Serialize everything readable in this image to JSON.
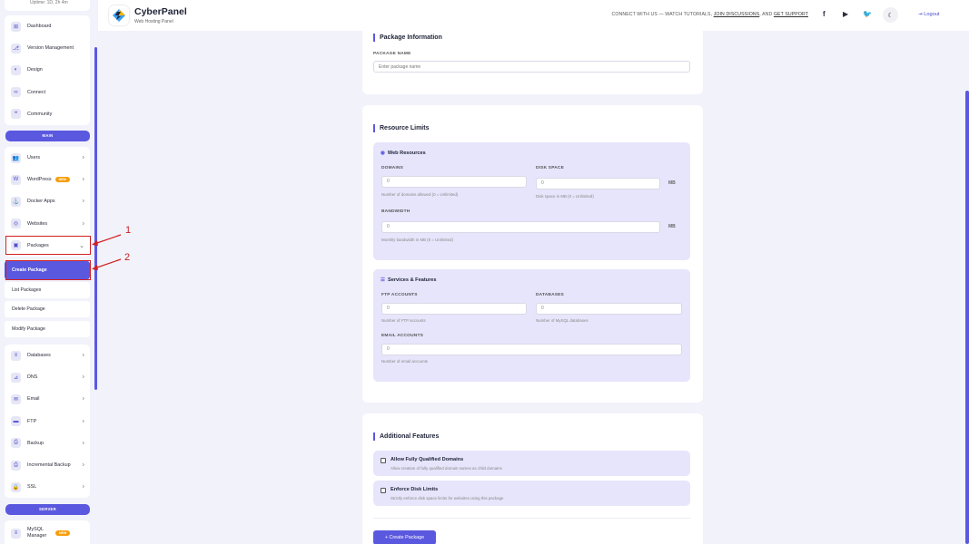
{
  "sidebar": {
    "uptime": "Uptime: 1D, 2h 4m",
    "top_items": [
      {
        "label": "Dashboard",
        "icon": "⊞"
      },
      {
        "label": "Version Management",
        "icon": "⎇"
      },
      {
        "label": "Design",
        "icon": "◐"
      },
      {
        "label": "Connect",
        "icon": "∞"
      },
      {
        "label": "Community",
        "icon": "❝"
      }
    ],
    "main_label": "MAIN",
    "main_items": [
      {
        "label": "Users",
        "icon": "👥"
      },
      {
        "label": "WordPress",
        "icon": "W",
        "badge": "NEW"
      },
      {
        "label": "Docker Apps",
        "icon": "⚓"
      },
      {
        "label": "Websites",
        "icon": "◎"
      },
      {
        "label": "Packages",
        "icon": "▣"
      }
    ],
    "package_sub": [
      "Create Package",
      "List Packages",
      "Delete Package",
      "Modify Package"
    ],
    "more_items": [
      {
        "label": "Databases",
        "icon": "≡"
      },
      {
        "label": "DNS",
        "icon": "⊿"
      },
      {
        "label": "Email",
        "icon": "✉"
      },
      {
        "label": "FTP",
        "icon": "▬"
      },
      {
        "label": "Backup",
        "icon": "⎙"
      },
      {
        "label": "Incremental Backup",
        "icon": "⎙"
      },
      {
        "label": "SSL",
        "icon": "🔒"
      }
    ],
    "server_label": "SERVER",
    "server_items": [
      {
        "label": "MySQL Manager",
        "icon": "≡",
        "badge": "NEW"
      }
    ]
  },
  "header": {
    "title": "CyberPanel",
    "subtitle": "Web Hosting Panel",
    "connect_prefix": "CONNECT WITH US — WATCH TUTORIALS,",
    "join_link": "JOIN DISCUSSIONS",
    "connect_mid": ", AND",
    "support_link": "GET SUPPORT",
    "logout": "Logout"
  },
  "package_info": {
    "title": "Package Information",
    "name_label": "PACKAGE NAME",
    "name_placeholder": "Enter package name"
  },
  "resource_limits": {
    "title": "Resource Limits",
    "web_resources": {
      "title": "Web Resources",
      "domains_label": "DOMAINS",
      "domains_value": "0",
      "domains_help": "Number of domains allowed (0 = Unlimited)",
      "disk_label": "DISK SPACE",
      "disk_value": "0",
      "disk_unit": "MB",
      "disk_help": "Disk space in MB (0 = Unlimited)",
      "bandwidth_label": "BANDWIDTH",
      "bandwidth_value": "0",
      "bandwidth_unit": "MB",
      "bandwidth_help": "Monthly bandwidth in MB (0 = Unlimited)"
    },
    "services": {
      "title": "Services & Features",
      "ftp_label": "FTP ACCOUNTS",
      "ftp_value": "0",
      "ftp_help": "Number of FTP accounts",
      "db_label": "DATABASES",
      "db_value": "0",
      "db_help": "Number of MySQL databases",
      "email_label": "EMAIL ACCOUNTS",
      "email_value": "0",
      "email_help": "Number of email accounts"
    }
  },
  "additional": {
    "title": "Additional Features",
    "fqdn_title": "Allow Fully Qualified Domains",
    "fqdn_desc": "Allow creation of fully qualified domain names as child domains",
    "disk_title": "Enforce Disk Limits",
    "disk_desc": "Strictly enforce disk space limits for websites using this package",
    "create_button": "+ Create Package"
  },
  "annotations": {
    "one": "1",
    "two": "2"
  },
  "colors": {
    "accent": "#5b58e0",
    "annotation": "#d12020",
    "badge": "#f59e0b"
  }
}
